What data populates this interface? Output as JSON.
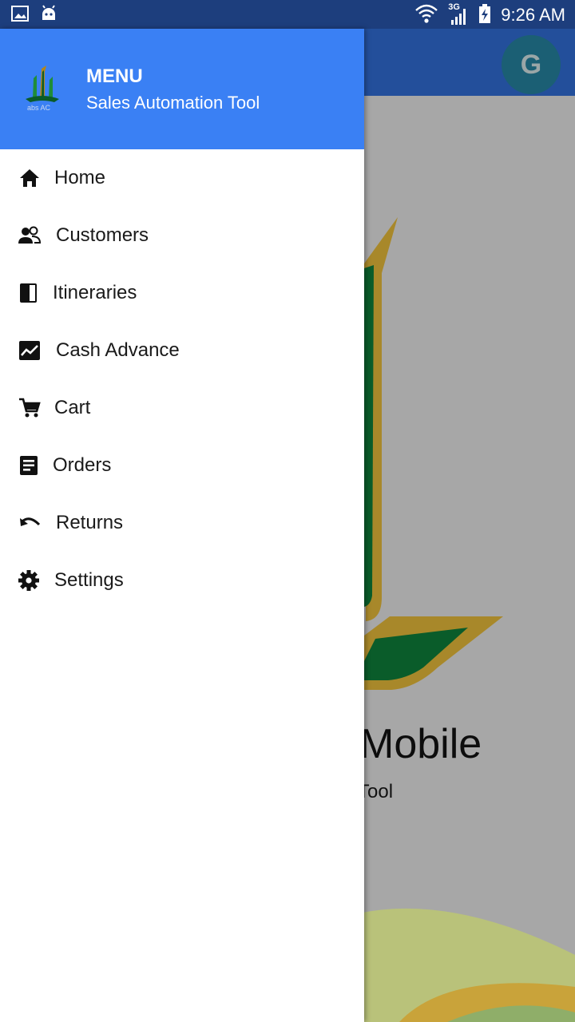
{
  "status_bar": {
    "network_label": "3G",
    "time": "9:26 AM"
  },
  "app_bar": {
    "avatar_initial": "G"
  },
  "background": {
    "title_fragment": "Mobile",
    "subtitle_fragment": "Tool"
  },
  "drawer": {
    "title": "MENU",
    "subtitle": "Sales Automation Tool",
    "items": [
      {
        "label": "Home",
        "icon": "home-icon"
      },
      {
        "label": "Customers",
        "icon": "people-icon"
      },
      {
        "label": "Itineraries",
        "icon": "book-icon"
      },
      {
        "label": "Cash Advance",
        "icon": "trending-icon"
      },
      {
        "label": "Cart",
        "icon": "cart-icon"
      },
      {
        "label": "Orders",
        "icon": "receipt-icon"
      },
      {
        "label": "Returns",
        "icon": "undo-icon"
      },
      {
        "label": "Settings",
        "icon": "gear-icon"
      }
    ]
  },
  "colors": {
    "status_bar": "#1d3e7d",
    "app_bar": "#234f9b",
    "drawer_header": "#3a80f4",
    "logo_green": "#0a5c2a",
    "logo_gold": "#b3861a"
  }
}
